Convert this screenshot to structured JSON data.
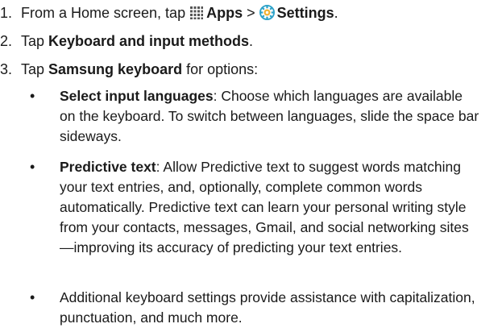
{
  "steps": [
    {
      "number": "1.",
      "prefix": "From a Home screen, tap ",
      "apps_icon": "apps-grid-icon",
      "apps_label": "Apps",
      "separator": " > ",
      "settings_icon": "settings-gear-icon",
      "settings_label": "Settings",
      "suffix": "."
    },
    {
      "number": "2.",
      "prefix": "Tap ",
      "bold": "Keyboard and input methods",
      "suffix": "."
    },
    {
      "number": "3.",
      "prefix": "Tap ",
      "bold": "Samsung keyboard",
      "suffix": " for options:"
    }
  ],
  "bullets": [
    {
      "bold": "Select input languages",
      "text": ": Choose which languages are available on the keyboard. To switch between languages, slide the space bar sideways."
    },
    {
      "bold": "Predictive text",
      "text": ": Allow Predictive text to suggest words matching your text entries, and, optionally, complete common words automatically. Predictive text can learn your personal writing style from your contacts, messages, Gmail, and social networking sites—improving its accuracy of predicting your text entries."
    },
    {
      "bold": "",
      "text": "Additional keyboard settings provide assistance with capitalization, punctuation, and much more."
    }
  ],
  "bullet_symbol": "•",
  "colors": {
    "text": "#1a1a1a",
    "apps_icon": "#555555",
    "settings_icon_outer": "#2ea3c9",
    "settings_icon_inner": "#f2b233"
  }
}
